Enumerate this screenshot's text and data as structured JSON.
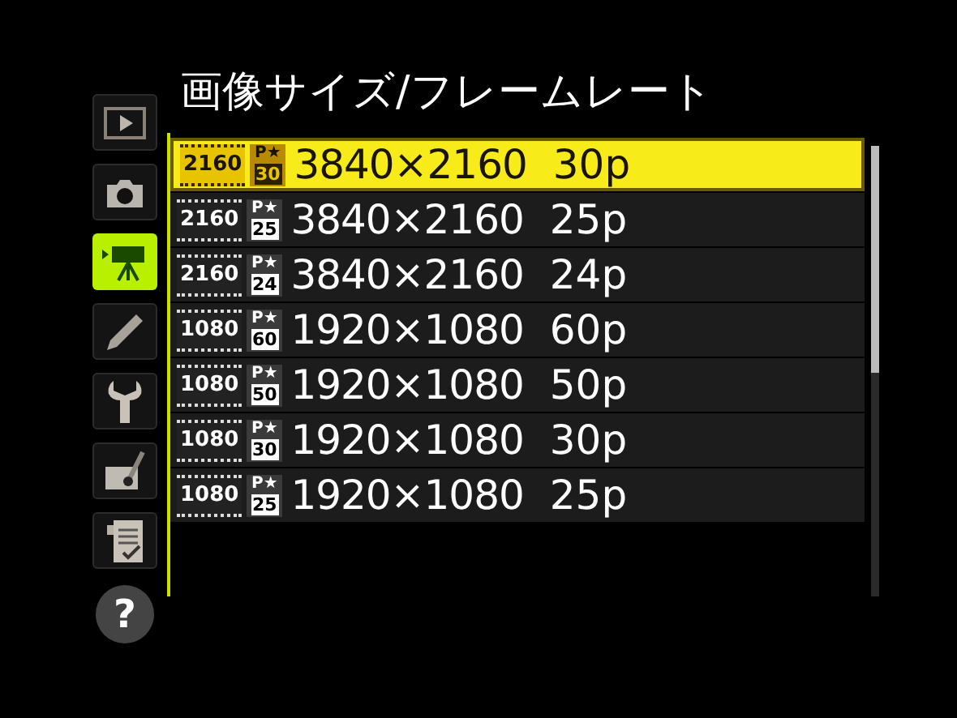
{
  "title": "画像サイズ/フレームレート",
  "sidebar": {
    "items": [
      {
        "kind": "playback",
        "selected": false
      },
      {
        "kind": "photo",
        "selected": false
      },
      {
        "kind": "movie",
        "selected": true
      },
      {
        "kind": "pencil",
        "selected": false
      },
      {
        "kind": "wrench",
        "selected": false
      },
      {
        "kind": "retouch",
        "selected": false
      },
      {
        "kind": "mymenu",
        "selected": false
      },
      {
        "kind": "help",
        "label": "?",
        "selected": false
      }
    ]
  },
  "options": [
    {
      "res": "2160",
      "mark": "P★",
      "rate": "30",
      "size": "3840×2160",
      "fps": "30p",
      "selected": true
    },
    {
      "res": "2160",
      "mark": "P★",
      "rate": "25",
      "size": "3840×2160",
      "fps": "25p",
      "selected": false
    },
    {
      "res": "2160",
      "mark": "P★",
      "rate": "24",
      "size": "3840×2160",
      "fps": "24p",
      "selected": false
    },
    {
      "res": "1080",
      "mark": "P★",
      "rate": "60",
      "size": "1920×1080",
      "fps": "60p",
      "selected": false
    },
    {
      "res": "1080",
      "mark": "P★",
      "rate": "50",
      "size": "1920×1080",
      "fps": "50p",
      "selected": false
    },
    {
      "res": "1080",
      "mark": "P★",
      "rate": "30",
      "size": "1920×1080",
      "fps": "30p",
      "selected": false
    },
    {
      "res": "1080",
      "mark": "P★",
      "rate": "25",
      "size": "1920×1080",
      "fps": "25p",
      "selected": false
    }
  ]
}
